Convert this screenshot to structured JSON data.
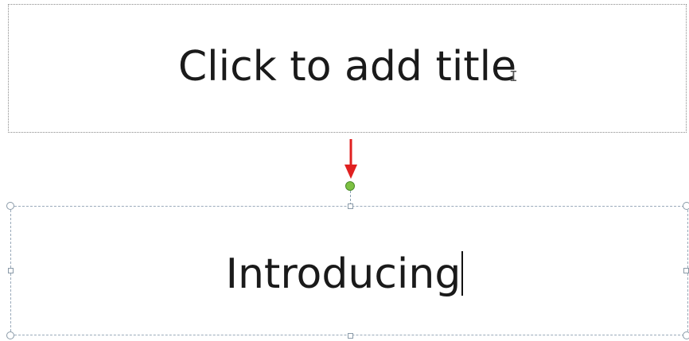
{
  "slide": {
    "title_placeholder": "Click to add title",
    "subtitle_text": "Introducing"
  },
  "annotation": {
    "arrow_color": "#e02020"
  },
  "colors": {
    "rotate_handle": "#7dc142",
    "selection_border": "#9aaaba"
  }
}
